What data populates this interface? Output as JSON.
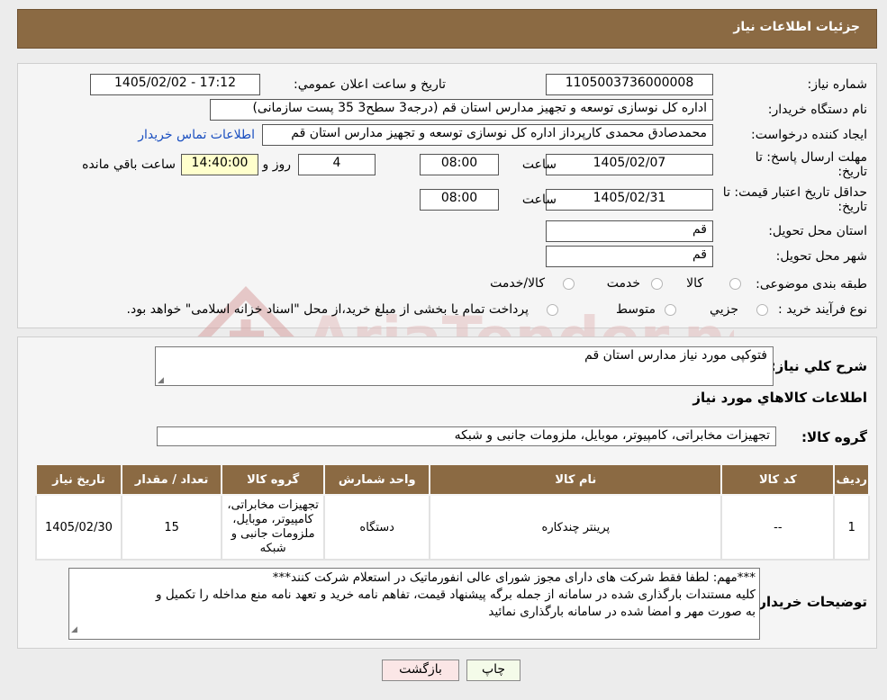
{
  "header": {
    "title": "جزئیات اطلاعات نیاز"
  },
  "form": {
    "need_number": {
      "label": "شماره نیاز:",
      "value": "1105003736000008"
    },
    "announce_datetime": {
      "label": "تاریخ و ساعت اعلان عمومي:",
      "value": "1405/02/02 - 17:12"
    },
    "buyer": {
      "label": "نام دستگاه خریدار:",
      "value": "اداره کل نوسازی   توسعه و تجهیز مدارس استان قم (درجه3 سطح3  35 پست سازمانی)"
    },
    "creator": {
      "label": "ایجاد کننده درخواست:",
      "value": "محمدصادق محمدی کارپرداز  اداره کل نوسازی   توسعه و تجهیز مدارس استان قم",
      "contact_link": "اطلاعات تماس خریدار"
    },
    "deadline": {
      "label": "مهلت ارسال پاسخ: تا تاریخ:",
      "date": "1405/02/07",
      "time_label": "ساعت",
      "time": "08:00",
      "days": "4",
      "days_label": "روز و",
      "remaining": "14:40:00",
      "remaining_label": "ساعت باقي مانده"
    },
    "validity": {
      "label": "حداقل تاریخ اعتبار قیمت: تا تاریخ:",
      "date": "1405/02/31",
      "time_label": "ساعت",
      "time": "08:00"
    },
    "province": {
      "label": "استان محل تحویل:",
      "value": "قم"
    },
    "city": {
      "label": "شهر محل تحویل:",
      "value": "قم"
    },
    "category": {
      "label": "طبقه بندی موضوعی:",
      "options": [
        "کالا",
        "خدمت",
        "کالا/خدمت"
      ]
    },
    "purchase_type": {
      "label": "نوع فرآیند خرید :",
      "options": [
        "جزيي",
        "متوسط"
      ],
      "note": "پرداخت تمام یا بخشی از مبلغ خرید،از محل \"اسناد خزانه اسلامی\" خواهد بود."
    }
  },
  "watermark": {
    "text": "AriaTender.neT"
  },
  "details": {
    "summary_label": "شرح کلي نیاز:",
    "summary_value": "فتوکپی مورد نیاز مدارس استان قم",
    "goods_section_title": "اطلاعات کالاهاي مورد نیاز",
    "goods_group_label": "گروه کالا:",
    "goods_group_value": "تجهیزات مخابراتی، کامپیوتر، موبایل، ملزومات جانبی و شبکه",
    "table": {
      "headers": [
        "ردیف",
        "کد کالا",
        "نام کالا",
        "واحد شمارش",
        "گروه کالا",
        "تعداد / مقدار",
        "تاریخ نیاز"
      ],
      "rows": [
        [
          "1",
          "--",
          "پرینتر چندکاره",
          "دستگاه",
          "تجهیزات مخابراتی، کامپیوتر، موبایل، ملزومات جانبی و شبکه",
          "15",
          "1405/02/30"
        ]
      ]
    },
    "buyer_notes_label": "توضیحات خریدار:",
    "buyer_notes_lines": [
      "***مهم: لطفا فقط شرکت های دارای مجوز شورای عالی انفورماتیک در استعلام شرکت کنند***",
      "کلیه مستندات بارگذاری شده در سامانه از جمله برگه پیشنهاد قیمت، تفاهم نامه خرید و تعهد نامه منع مداخله را تکمیل و",
      "به صورت مهر و امضا شده در سامانه بارگذاری نمائید"
    ]
  },
  "buttons": {
    "print": "چاپ",
    "back": "بازگشت"
  }
}
